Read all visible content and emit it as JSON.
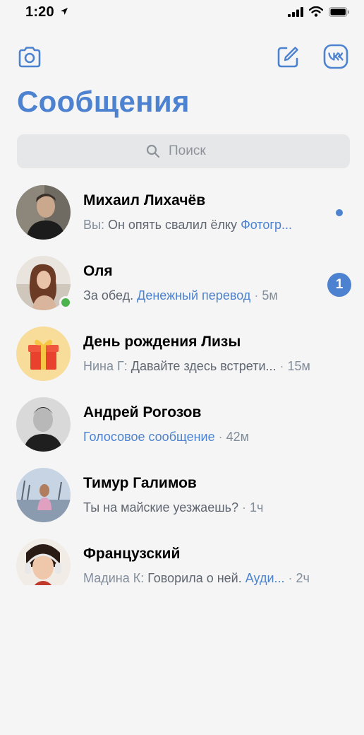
{
  "status_bar": {
    "time": "1:20"
  },
  "header": {
    "title": "Сообщения"
  },
  "search": {
    "placeholder": "Поиск"
  },
  "chats": [
    {
      "name": "Михаил Лихачёв",
      "prefix": "Вы: ",
      "message": "Он опять свалил ёлку ",
      "attachment": "Фотогр...",
      "time": "",
      "unread_dot": true
    },
    {
      "name": "Оля",
      "prefix": "",
      "message": "За обед. ",
      "attachment": "Денежный перевод",
      "time": "5м",
      "unread_count": "1",
      "online": true
    },
    {
      "name": "День рождения Лизы",
      "prefix": "Нина Г: ",
      "message": "Давайте здесь встрети...",
      "attachment": "",
      "time": "15м"
    },
    {
      "name": "Андрей Рогозов",
      "prefix": "",
      "message": "",
      "attachment": "Голосовое сообщение",
      "time": "42м"
    },
    {
      "name": "Тимур Галимов",
      "prefix": "",
      "message": "Ты на майские уезжаешь?",
      "attachment": "",
      "time": "1ч"
    },
    {
      "name": "Французский",
      "prefix": "Мадина К: ",
      "message": "Говорила о ней. ",
      "attachment": "Ауди...",
      "time": "2ч"
    }
  ],
  "colors": {
    "accent": "#4c82cf",
    "online": "#4bb34b",
    "secondary_text": "#818c99"
  }
}
